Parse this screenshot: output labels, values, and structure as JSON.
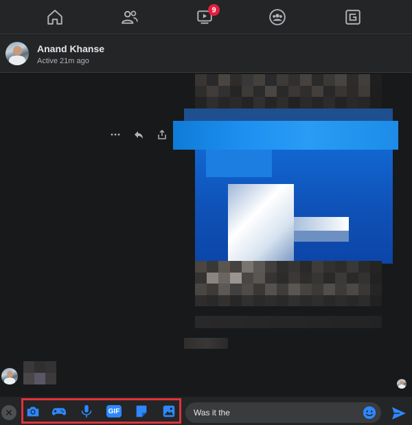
{
  "nav": {
    "items": [
      {
        "icon": "home-icon"
      },
      {
        "icon": "friends-icon"
      },
      {
        "icon": "watch-icon",
        "badge": "9"
      },
      {
        "icon": "groups-icon"
      },
      {
        "icon": "gaming-icon"
      }
    ]
  },
  "contact": {
    "name": "Anand Khanse",
    "status": "Active 21m ago"
  },
  "message_actions": [
    "more-icon",
    "reply-icon",
    "share-icon"
  ],
  "composer": {
    "tools": [
      "camera-icon",
      "game-controller-icon",
      "microphone-icon",
      "gif-icon",
      "sticker-icon",
      "image-icon"
    ],
    "gif_label": "GIF",
    "input_value": "Was it the",
    "close_label": "✕"
  },
  "colors": {
    "accent": "#2d88ff",
    "badge": "#e41e3f",
    "highlight_box": "#e2323a"
  }
}
